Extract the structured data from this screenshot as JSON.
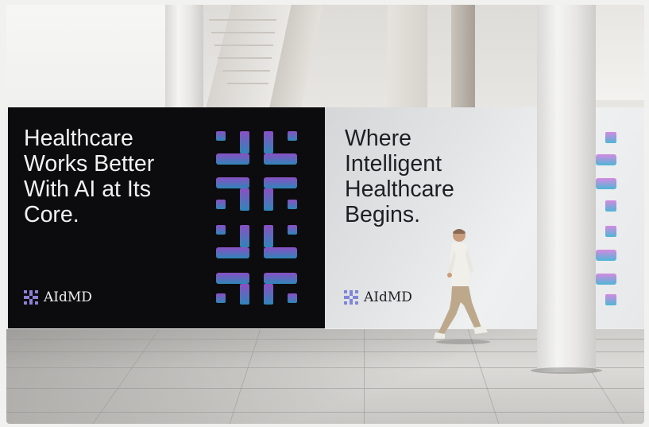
{
  "billboard_dark": {
    "headline": "Healthcare\nWorks Better\nWith AI at Its\nCore.",
    "brand_name": "AIdMD"
  },
  "billboard_light": {
    "headline": "Where\nIntelligent\nHealthcare\nBegins.",
    "brand_name": "AIdMD"
  },
  "colors": {
    "dark_panel": "#0c0c0e",
    "light_panel": "#e6e8ea",
    "gradient_top": "#8a4fc4",
    "gradient_bottom": "#2f86b8",
    "strip_top": "#d48ae0",
    "strip_bottom": "#4fb6d6"
  }
}
